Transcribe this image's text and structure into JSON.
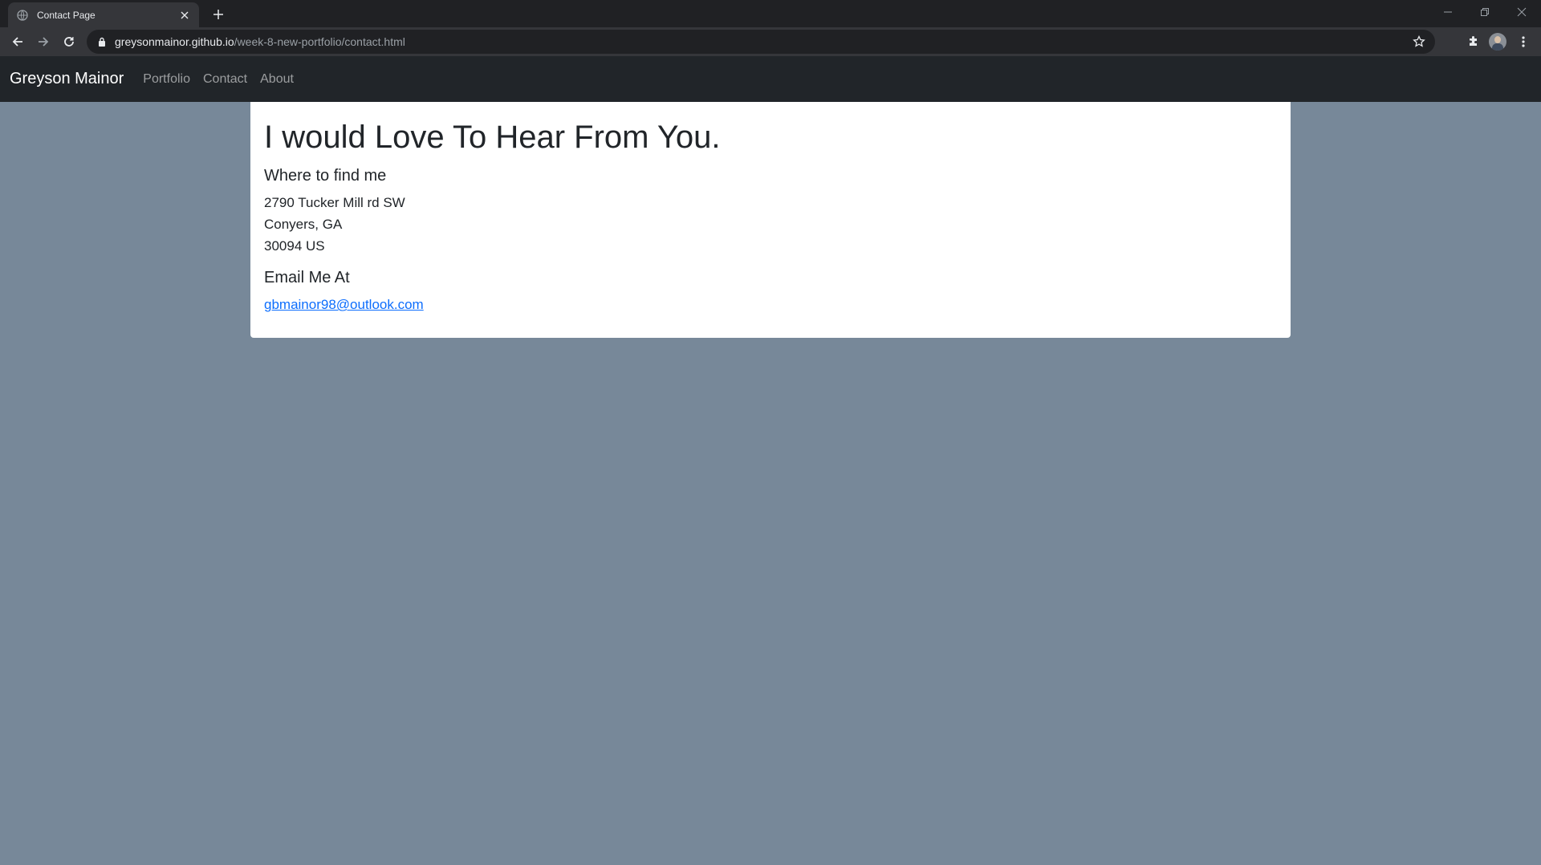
{
  "browser": {
    "tab_title": "Contact Page",
    "url_host": "greysonmainor.github.io",
    "url_path": "/week-8-new-portfolio/contact.html"
  },
  "site": {
    "brand": "Greyson Mainor",
    "nav": [
      {
        "label": "Portfolio"
      },
      {
        "label": "Contact"
      },
      {
        "label": "About"
      }
    ]
  },
  "content": {
    "heading": "I would Love To Hear From You.",
    "location_heading": "Where to find me",
    "address_lines": [
      "2790 Tucker Mill rd SW",
      "Conyers, GA",
      "30094 US"
    ],
    "email_heading": "Email Me At",
    "email": "gbmainor98@outlook.com"
  },
  "colors": {
    "page_background": "#778899",
    "navbar": "#212529",
    "link": "#0d6efd"
  }
}
